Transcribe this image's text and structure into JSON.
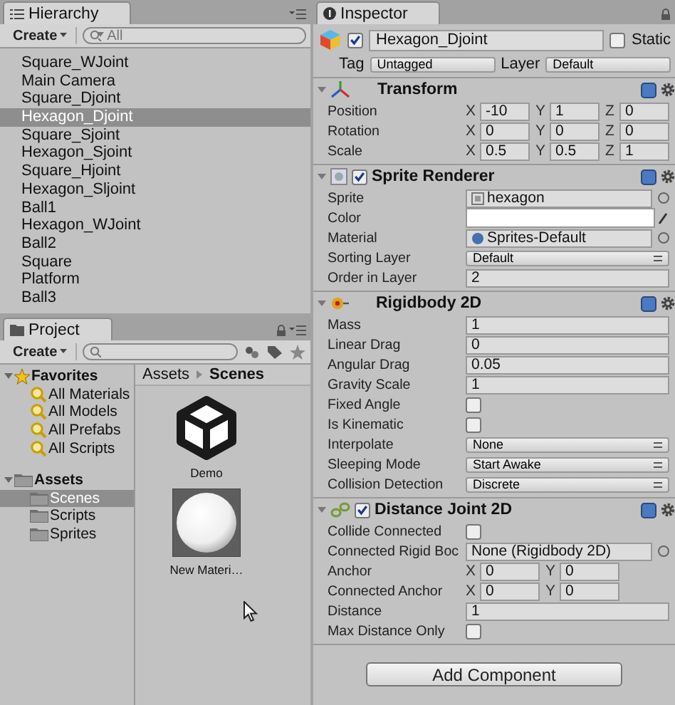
{
  "hierarchy": {
    "title": "Hierarchy",
    "create": "Create",
    "search_placeholder": "All",
    "items": [
      {
        "label": "Square_WJoint",
        "selected": false
      },
      {
        "label": "Main Camera",
        "selected": false
      },
      {
        "label": "Square_Djoint",
        "selected": false
      },
      {
        "label": "Hexagon_Djoint",
        "selected": true
      },
      {
        "label": "Square_Sjoint",
        "selected": false
      },
      {
        "label": "Hexagon_Sjoint",
        "selected": false
      },
      {
        "label": "Square_Hjoint",
        "selected": false
      },
      {
        "label": "Hexagon_Sljoint",
        "selected": false
      },
      {
        "label": "Ball1",
        "selected": false
      },
      {
        "label": "Hexagon_WJoint",
        "selected": false
      },
      {
        "label": "Ball2",
        "selected": false
      },
      {
        "label": "Square",
        "selected": false
      },
      {
        "label": "Platform",
        "selected": false
      },
      {
        "label": "Ball3",
        "selected": false
      }
    ]
  },
  "project": {
    "title": "Project",
    "create": "Create",
    "tree": [
      {
        "label": "Favorites",
        "kind": "favorites",
        "expanded": true,
        "selected": false,
        "children": [
          {
            "label": "All Materials",
            "kind": "search",
            "selected": false
          },
          {
            "label": "All Models",
            "kind": "search",
            "selected": false
          },
          {
            "label": "All Prefabs",
            "kind": "search",
            "selected": false
          },
          {
            "label": "All Scripts",
            "kind": "search",
            "selected": false
          }
        ]
      },
      {
        "label": "Assets",
        "kind": "folder",
        "expanded": true,
        "selected": false,
        "children": [
          {
            "label": "Scenes",
            "kind": "folder",
            "selected": true
          },
          {
            "label": "Scripts",
            "kind": "folder",
            "selected": false
          },
          {
            "label": "Sprites",
            "kind": "folder",
            "selected": false
          }
        ]
      }
    ],
    "breadcrumb": [
      "Assets",
      "Scenes"
    ],
    "files": [
      {
        "name": "Demo",
        "kind": "scene"
      },
      {
        "name": "New Materi…",
        "kind": "material"
      }
    ]
  },
  "inspector": {
    "title": "Inspector",
    "object": {
      "name": "Hexagon_Djoint",
      "active": true,
      "static": false,
      "static_label": "Static",
      "tag_label": "Tag",
      "tag": "Untagged",
      "layer_label": "Layer",
      "layer": "Default"
    },
    "components": [
      {
        "title": "Transform",
        "kind": "transform",
        "rows": [
          {
            "label": "Position",
            "kind": "vector",
            "values": [
              {
                "axis": "X",
                "value": "-10"
              },
              {
                "axis": "Y",
                "value": "1"
              },
              {
                "axis": "Z",
                "value": "0"
              }
            ]
          },
          {
            "label": "Rotation",
            "kind": "vector",
            "values": [
              {
                "axis": "X",
                "value": "0"
              },
              {
                "axis": "Y",
                "value": "0"
              },
              {
                "axis": "Z",
                "value": "0"
              }
            ]
          },
          {
            "label": "Scale",
            "kind": "vector",
            "values": [
              {
                "axis": "X",
                "value": "0.5"
              },
              {
                "axis": "Y",
                "value": "0.5"
              },
              {
                "axis": "Z",
                "value": "1"
              }
            ]
          }
        ]
      },
      {
        "title": "Sprite Renderer",
        "kind": "sprite",
        "enabled": true,
        "rows": [
          {
            "label": "Sprite",
            "kind": "sprite",
            "value": "hexagon"
          },
          {
            "label": "Color",
            "kind": "color",
            "color": "#ffffff"
          },
          {
            "label": "Material",
            "kind": "material",
            "value": "Sprites-Default"
          },
          {
            "label": "Sorting Layer",
            "kind": "dropdown",
            "value": "Default"
          },
          {
            "label": "Order in Layer",
            "kind": "field",
            "value": "2"
          }
        ]
      },
      {
        "title": "Rigidbody 2D",
        "kind": "rigidbody",
        "rows": [
          {
            "label": "Mass",
            "kind": "field",
            "value": "1"
          },
          {
            "label": "Linear Drag",
            "kind": "field",
            "value": "0"
          },
          {
            "label": "Angular Drag",
            "kind": "field",
            "value": "0.05"
          },
          {
            "label": "Gravity Scale",
            "kind": "field",
            "value": "1"
          },
          {
            "label": "Fixed Angle",
            "kind": "checkbox",
            "checked": false
          },
          {
            "label": "Is Kinematic",
            "kind": "checkbox",
            "checked": false
          },
          {
            "label": "Interpolate",
            "kind": "dropdown",
            "value": "None"
          },
          {
            "label": "Sleeping Mode",
            "kind": "dropdown",
            "value": "Start Awake"
          },
          {
            "label": "Collision Detection",
            "kind": "dropdown",
            "value": "Discrete"
          }
        ]
      },
      {
        "title": "Distance Joint 2D",
        "kind": "joint",
        "enabled": true,
        "rows": [
          {
            "label": "Collide Connected",
            "kind": "checkbox",
            "checked": false
          },
          {
            "label": "Connected Rigid Boc",
            "kind": "object",
            "value": "None (Rigidbody 2D)"
          },
          {
            "label": "Anchor",
            "kind": "vector",
            "values": [
              {
                "axis": "X",
                "value": "0"
              },
              {
                "axis": "Y",
                "value": "0"
              }
            ]
          },
          {
            "label": "Connected Anchor",
            "kind": "vector",
            "values": [
              {
                "axis": "X",
                "value": "0"
              },
              {
                "axis": "Y",
                "value": "0"
              }
            ]
          },
          {
            "label": "Distance",
            "kind": "field",
            "value": "1"
          },
          {
            "label": "Max Distance Only",
            "kind": "checkbox",
            "checked": false
          }
        ]
      }
    ],
    "add_button": "Add Component"
  }
}
